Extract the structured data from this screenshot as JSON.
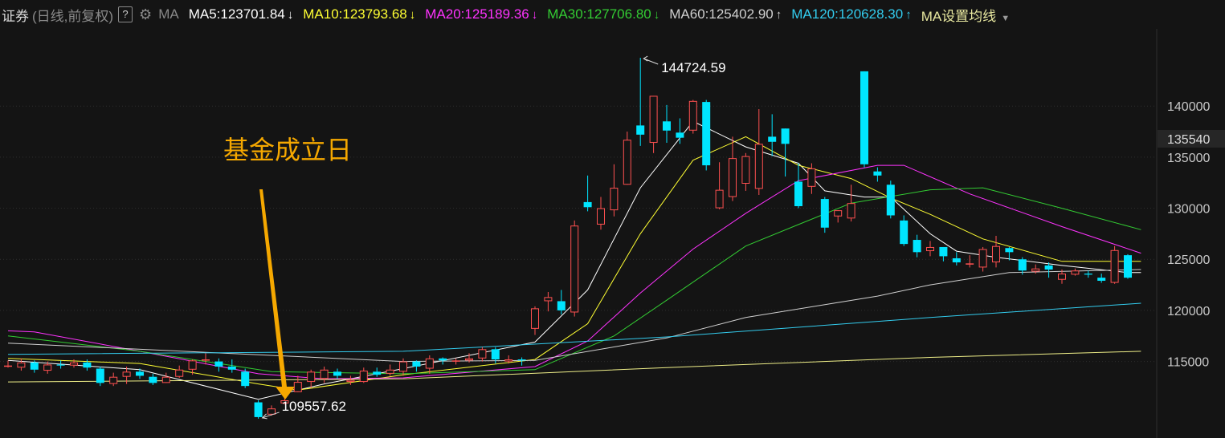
{
  "header": {
    "title": "证券",
    "params": "(日线,前复权)",
    "help": "?",
    "indicator": "MA",
    "settings": "MA设置均线"
  },
  "ma_legend": [
    {
      "text": "MA5:123701.84",
      "arrow": "↓",
      "color": "#ffffff"
    },
    {
      "text": "MA10:123793.68",
      "arrow": "↓",
      "color": "#ffff33"
    },
    {
      "text": "MA20:125189.36",
      "arrow": "↓",
      "color": "#ff33ff"
    },
    {
      "text": "MA30:127706.80",
      "arrow": "↓",
      "color": "#33cc33"
    },
    {
      "text": "MA60:125402.90",
      "arrow": "↑",
      "color": "#d0d0d0"
    },
    {
      "text": "MA120:120628.30",
      "arrow": "↑",
      "color": "#33ccee"
    }
  ],
  "chart_data": {
    "type": "candlestick",
    "y_ticks": [
      115000,
      120000,
      125000,
      130000,
      135000,
      140000
    ],
    "ylim": [
      108000,
      147000
    ],
    "current_price": "135540",
    "annotations": {
      "max": {
        "value": 144724.59,
        "label": "144724.59"
      },
      "min": {
        "value": 109557.62,
        "label": "109557.62"
      },
      "note": "基金成立日"
    },
    "colors": {
      "up": "#ff5050",
      "down": "#00e5ff",
      "grid": "#2e2e2e",
      "note": "#f5a800",
      "axis_text": "#c8c8c8"
    },
    "candles": [
      [
        114600,
        114600,
        115100,
        114400
      ],
      [
        114400,
        114900,
        115300,
        114100
      ],
      [
        114900,
        114200,
        115100,
        113900
      ],
      [
        114100,
        114700,
        115000,
        113800
      ],
      [
        114700,
        114600,
        115100,
        114300
      ],
      [
        114600,
        114900,
        115200,
        114400
      ],
      [
        114900,
        114400,
        115200,
        114100
      ],
      [
        114300,
        112900,
        114500,
        112600
      ],
      [
        112800,
        113500,
        113900,
        112600
      ],
      [
        113500,
        114000,
        114500,
        112800
      ],
      [
        114000,
        113600,
        114300,
        113300
      ],
      [
        113500,
        112900,
        113800,
        112700
      ],
      [
        112900,
        113500,
        113900,
        112900
      ],
      [
        113500,
        114200,
        114600,
        113400
      ],
      [
        114200,
        115100,
        115200,
        113700
      ],
      [
        115200,
        115200,
        115800,
        114700
      ],
      [
        115000,
        114500,
        115300,
        114000
      ],
      [
        114500,
        114200,
        115200,
        113900
      ],
      [
        114000,
        112600,
        114300,
        112400
      ],
      [
        111000,
        109557.62,
        111200,
        109400
      ],
      [
        109800,
        110400,
        110700,
        109700
      ],
      [
        110900,
        111200,
        111600,
        110800
      ],
      [
        112000,
        113000,
        113600,
        112000
      ],
      [
        113000,
        114000,
        114200,
        112400
      ],
      [
        113300,
        114200,
        114500,
        112900
      ],
      [
        114000,
        113600,
        114300,
        113300
      ],
      [
        113000,
        113200,
        113600,
        112700
      ],
      [
        113000,
        114100,
        114400,
        112900
      ],
      [
        114000,
        113700,
        114400,
        113500
      ],
      [
        113800,
        114200,
        114700,
        113600
      ],
      [
        114000,
        115000,
        115300,
        113600
      ],
      [
        115000,
        114500,
        115100,
        114000
      ],
      [
        114300,
        115300,
        115600,
        113800
      ],
      [
        115300,
        115100,
        115400,
        114700
      ],
      [
        115100,
        115100,
        115300,
        114700
      ],
      [
        115100,
        115300,
        115800,
        114900
      ],
      [
        115300,
        116200,
        116400,
        115000
      ],
      [
        116200,
        115200,
        116400,
        114800
      ],
      [
        115000,
        115200,
        115600,
        114800
      ],
      [
        115200,
        115100,
        115400,
        114600
      ],
      [
        118200,
        120200,
        120400,
        117600
      ],
      [
        120900,
        121300,
        121800,
        119900
      ],
      [
        120900,
        120000,
        122000,
        119600
      ],
      [
        119800,
        128300,
        128800,
        119400
      ],
      [
        130600,
        130100,
        133200,
        129700
      ],
      [
        128400,
        130000,
        131100,
        127900
      ],
      [
        129800,
        132000,
        134300,
        129200
      ],
      [
        132300,
        136700,
        137500,
        132300
      ],
      [
        138100,
        137200,
        144724.59,
        136100
      ],
      [
        136400,
        141000,
        141000,
        135400
      ],
      [
        138500,
        137600,
        140100,
        136400
      ],
      [
        137400,
        136900,
        138800,
        136300
      ],
      [
        137600,
        140500,
        140600,
        137300
      ],
      [
        140400,
        134200,
        140600,
        133700
      ],
      [
        130000,
        131800,
        134500,
        129900
      ],
      [
        131100,
        134900,
        137000,
        130700
      ],
      [
        132400,
        135100,
        135400,
        131700
      ],
      [
        131900,
        136300,
        139700,
        131300
      ],
      [
        137000,
        136500,
        139200,
        135100
      ],
      [
        137800,
        136300,
        137800,
        133100
      ],
      [
        132600,
        130200,
        134400,
        130000
      ],
      [
        132100,
        133900,
        134400,
        131400
      ],
      [
        130900,
        128100,
        131100,
        127600
      ],
      [
        129200,
        129800,
        129800,
        128600
      ],
      [
        129000,
        130500,
        132300,
        128700
      ],
      [
        143400,
        134300,
        143400,
        134000
      ],
      [
        133600,
        133200,
        134000,
        132600
      ],
      [
        132300,
        129300,
        132700,
        129000
      ],
      [
        128800,
        126500,
        129300,
        126300
      ],
      [
        126900,
        125700,
        127400,
        125200
      ],
      [
        125800,
        126200,
        126800,
        125300
      ],
      [
        126200,
        125300,
        126200,
        124800
      ],
      [
        125100,
        124700,
        125700,
        124400
      ],
      [
        124600,
        124600,
        125400,
        124200
      ],
      [
        124200,
        126000,
        126200,
        123800
      ],
      [
        124700,
        126300,
        127300,
        124200
      ],
      [
        126100,
        125700,
        126200,
        124900
      ],
      [
        125000,
        123900,
        125200,
        123500
      ],
      [
        123800,
        124100,
        124500,
        123600
      ],
      [
        124400,
        124000,
        124700,
        123200
      ],
      [
        123000,
        123600,
        124000,
        122600
      ],
      [
        123500,
        123900,
        124100,
        123400
      ],
      [
        123600,
        123500,
        123900,
        123200
      ],
      [
        123200,
        122900,
        123600,
        122700
      ],
      [
        122700,
        125900,
        126300,
        122600
      ],
      [
        125400,
        123200,
        125500,
        123100
      ]
    ],
    "ma_lines": [
      {
        "name": "MA5",
        "color": "#ffffff",
        "points": [
          [
            0,
            115100
          ],
          [
            10,
            114200
          ],
          [
            19,
            111300
          ],
          [
            24,
            112800
          ],
          [
            30,
            114300
          ],
          [
            40,
            116900
          ],
          [
            44,
            122000
          ],
          [
            48,
            132000
          ],
          [
            52,
            138500
          ],
          [
            56,
            136000
          ],
          [
            60,
            134400
          ],
          [
            62,
            131700
          ],
          [
            65,
            131100
          ],
          [
            67,
            131100
          ],
          [
            70,
            127500
          ],
          [
            72,
            125800
          ],
          [
            75,
            125200
          ],
          [
            80,
            124400
          ],
          [
            85,
            123700
          ],
          [
            86,
            123700
          ]
        ]
      },
      {
        "name": "MA10",
        "color": "#ffff33",
        "points": [
          [
            0,
            115300
          ],
          [
            10,
            114800
          ],
          [
            19,
            112800
          ],
          [
            22,
            112200
          ],
          [
            30,
            113700
          ],
          [
            40,
            115200
          ],
          [
            44,
            118700
          ],
          [
            48,
            127500
          ],
          [
            52,
            134700
          ],
          [
            56,
            137000
          ],
          [
            60,
            134200
          ],
          [
            64,
            132900
          ],
          [
            67,
            131000
          ],
          [
            70,
            129400
          ],
          [
            74,
            127000
          ],
          [
            80,
            124800
          ],
          [
            86,
            124800
          ]
        ]
      },
      {
        "name": "MA20",
        "color": "#ff33ff",
        "points": [
          [
            0,
            118000
          ],
          [
            2,
            117900
          ],
          [
            10,
            116000
          ],
          [
            19,
            113800
          ],
          [
            24,
            113300
          ],
          [
            30,
            113400
          ],
          [
            40,
            114500
          ],
          [
            44,
            117000
          ],
          [
            48,
            121700
          ],
          [
            52,
            126000
          ],
          [
            56,
            129500
          ],
          [
            60,
            132700
          ],
          [
            66,
            134200
          ],
          [
            68,
            134200
          ],
          [
            73,
            131400
          ],
          [
            80,
            128200
          ],
          [
            86,
            125600
          ]
        ]
      },
      {
        "name": "MA30",
        "color": "#33cc33",
        "points": [
          [
            0,
            117500
          ],
          [
            10,
            116000
          ],
          [
            20,
            114000
          ],
          [
            30,
            113800
          ],
          [
            40,
            114200
          ],
          [
            46,
            117500
          ],
          [
            50,
            121000
          ],
          [
            56,
            126300
          ],
          [
            60,
            128400
          ],
          [
            64,
            130500
          ],
          [
            70,
            131800
          ],
          [
            74,
            132000
          ],
          [
            80,
            130000
          ],
          [
            86,
            127900
          ]
        ]
      },
      {
        "name": "MA60",
        "color": "#d0d0d0",
        "points": [
          [
            0,
            116800
          ],
          [
            20,
            115600
          ],
          [
            30,
            115000
          ],
          [
            40,
            115100
          ],
          [
            50,
            117300
          ],
          [
            56,
            119300
          ],
          [
            66,
            121400
          ],
          [
            70,
            122500
          ],
          [
            76,
            123700
          ],
          [
            86,
            124000
          ]
        ]
      },
      {
        "name": "MA120",
        "color": "#33ccee",
        "points": [
          [
            0,
            115700
          ],
          [
            30,
            116000
          ],
          [
            50,
            117400
          ],
          [
            70,
            119300
          ],
          [
            86,
            120700
          ]
        ]
      },
      {
        "name": "MA250",
        "color": "#eeee88",
        "points": [
          [
            0,
            113000
          ],
          [
            30,
            113300
          ],
          [
            50,
            114400
          ],
          [
            70,
            115400
          ],
          [
            86,
            116000
          ]
        ]
      }
    ]
  }
}
